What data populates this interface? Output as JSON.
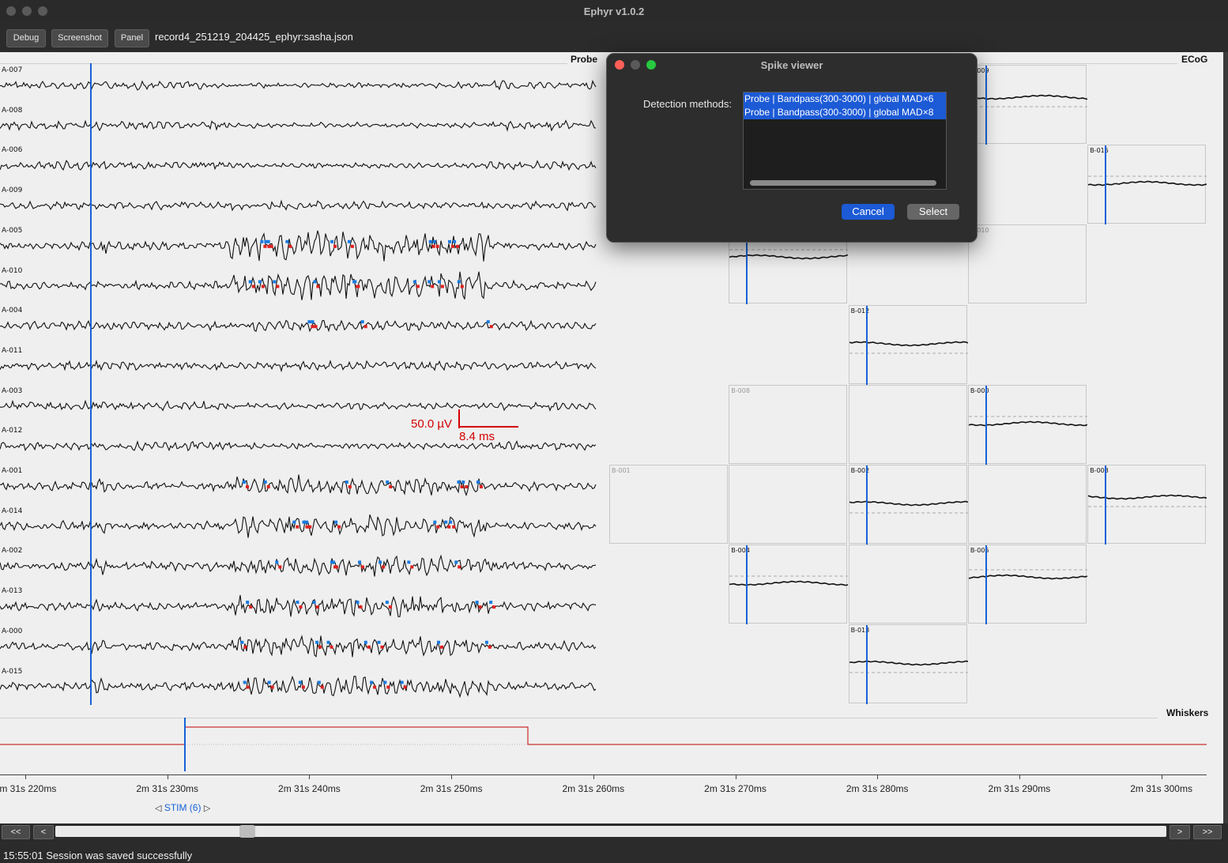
{
  "window": {
    "title": "Ephyr v1.0.2"
  },
  "toolbar": {
    "debug_label": "Debug",
    "screenshot_label": "Screenshot",
    "panel_label": "Panel",
    "filename": "record4_251219_204425_ephyr:sasha.json"
  },
  "probe": {
    "label": "Probe",
    "channels": [
      "A-007",
      "A-008",
      "A-006",
      "A-009",
      "A-005",
      "A-010",
      "A-004",
      "A-011",
      "A-003",
      "A-012",
      "A-001",
      "A-014",
      "A-002",
      "A-013",
      "A-000",
      "A-015"
    ],
    "scale_voltage": "50.0 µV",
    "scale_time": "8.4 ms"
  },
  "ecog": {
    "label": "ECoG",
    "cells": [
      {
        "label": "B-009",
        "row": 0,
        "col": 3,
        "active": true
      },
      {
        "label": "B-015",
        "row": 1,
        "col": 4,
        "active": true
      },
      {
        "label": "B-010",
        "row": 2,
        "col": 3,
        "active": false
      },
      {
        "label": "",
        "row": 2,
        "col": 1,
        "active": true
      },
      {
        "label": "B-012",
        "row": 3,
        "col": 2,
        "active": true
      },
      {
        "label": "B-008",
        "row": 4,
        "col": 1,
        "active": false
      },
      {
        "label": "",
        "row": 4,
        "col": 2,
        "active": false
      },
      {
        "label": "B-000",
        "row": 4,
        "col": 3,
        "active": true
      },
      {
        "label": "B-001",
        "row": 5,
        "col": 0,
        "active": false
      },
      {
        "label": "",
        "row": 5,
        "col": 1,
        "active": false
      },
      {
        "label": "B-002",
        "row": 5,
        "col": 2,
        "active": true
      },
      {
        "label": "",
        "row": 5,
        "col": 3,
        "active": false
      },
      {
        "label": "B-003",
        "row": 5,
        "col": 4,
        "active": true
      },
      {
        "label": "B-004",
        "row": 6,
        "col": 1,
        "active": true
      },
      {
        "label": "",
        "row": 6,
        "col": 2,
        "active": false
      },
      {
        "label": "B-005",
        "row": 6,
        "col": 3,
        "active": true
      },
      {
        "label": "B-013",
        "row": 7,
        "col": 2,
        "active": true
      }
    ]
  },
  "whiskers": {
    "label": "Whiskers"
  },
  "time_axis": {
    "ticks": [
      "2m 31s 220ms",
      "2m 31s 230ms",
      "2m 31s 240ms",
      "2m 31s 250ms",
      "2m 31s 260ms",
      "2m 31s 270ms",
      "2m 31s 280ms",
      "2m 31s 290ms",
      "2m 31s 300ms"
    ]
  },
  "stim": {
    "label": "STIM (6)",
    "prev_icon": "triangle-left-icon",
    "next_icon": "triangle-right-icon"
  },
  "navigation": {
    "first_label": "<<",
    "prev_label": "<",
    "next_label": ">",
    "last_label": ">>"
  },
  "status": {
    "message": "15:55:01 Session was saved successfully"
  },
  "dialog": {
    "title": "Spike viewer",
    "detection_label": "Detection methods:",
    "methods": [
      "Probe | Bandpass(300-3000) | global MAD×6",
      "Probe | Bandpass(300-3000) | global MAD×8"
    ],
    "cancel_label": "Cancel",
    "select_label": "Select"
  },
  "colors": {
    "cursor": "#1662d8",
    "spike_red": "#e02020",
    "spike_blue": "#1a7ae0",
    "scale_bar": "#d40000",
    "whisker_line": "#c00000",
    "selection": "#1c5ad6"
  }
}
